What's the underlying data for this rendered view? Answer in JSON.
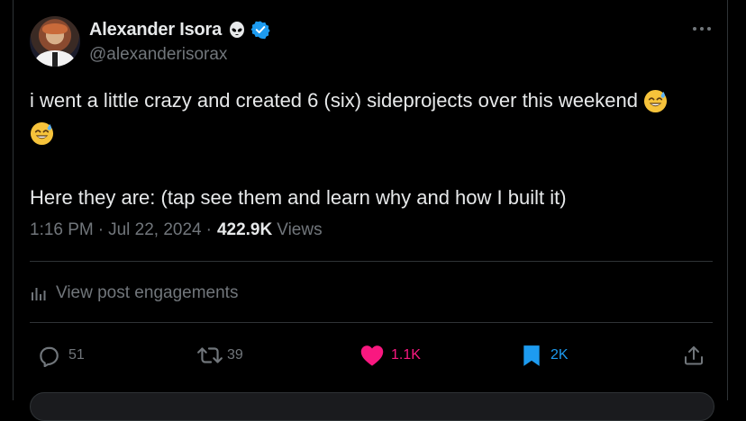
{
  "user": {
    "name": "Alexander Isora",
    "handle": "@alexanderisorax"
  },
  "tweet": {
    "line1": "i went a little crazy and created 6 (six) sideprojects over this weekend",
    "line2": "Here they are: (tap see them and learn why and how I built it)",
    "emoji": "sweat-smile-emoji"
  },
  "meta": {
    "time": "1:16 PM",
    "date": "Jul 22, 2024",
    "separator": "·",
    "views_count": "422.9K",
    "views_label": "Views"
  },
  "engagements_label": "View post engagements",
  "actions": {
    "replies": "51",
    "reposts": "39",
    "likes": "1.1K",
    "bookmarks": "2K"
  },
  "colors": {
    "background": "#000000",
    "text": "#e7e9ea",
    "muted": "#71767b",
    "verified": "#1d9bf0",
    "like": "#f91880",
    "bookmark": "#1d9bf0"
  },
  "icons": [
    "alien-icon",
    "verified-badge-icon",
    "more-icon",
    "analytics-icon",
    "reply-icon",
    "repost-icon",
    "like-icon",
    "bookmark-icon",
    "share-icon"
  ]
}
